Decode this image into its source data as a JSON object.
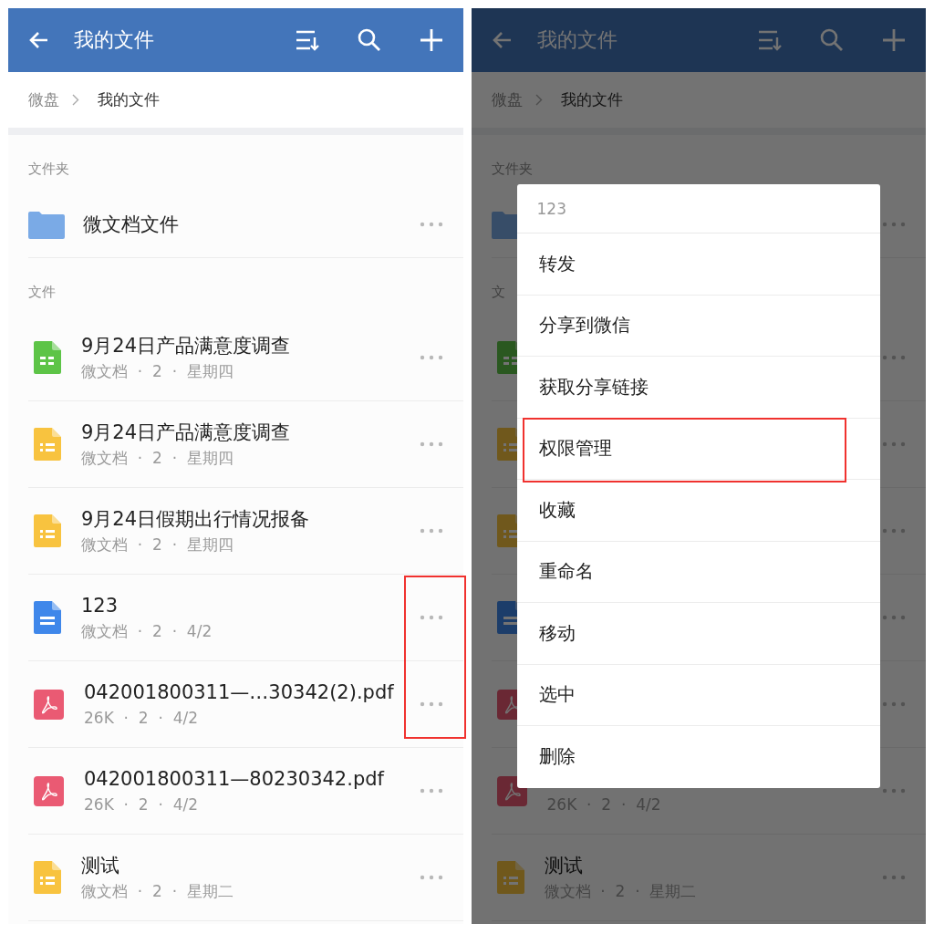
{
  "screens": [
    {
      "kind": "plain",
      "title": "我的文件",
      "breadcrumb": [
        {
          "label": "微盘",
          "current": false
        },
        {
          "label": "我的文件",
          "current": true
        }
      ],
      "sections": [
        {
          "label": "文件夹",
          "items": [
            {
              "kind": "folder",
              "name": "微文档文件",
              "highlighted": false
            }
          ]
        },
        {
          "label": "文件",
          "items": [
            {
              "kind": "sheet",
              "name": "9月24日产品满意度调查",
              "meta": "微文档  ·  2  ·  星期四",
              "highlighted": false
            },
            {
              "kind": "form",
              "name": "9月24日产品满意度调查",
              "meta": "微文档  ·  2  ·  星期四",
              "highlighted": false
            },
            {
              "kind": "form",
              "name": "9月24日假期出行情况报备",
              "meta": "微文档  ·  2  ·  星期四",
              "highlighted": false
            },
            {
              "kind": "doc",
              "name": "123",
              "meta": "微文档  ·  2  ·  4/2",
              "highlighted": true
            },
            {
              "kind": "pdf",
              "name": "042001800311—…30342(2).pdf",
              "meta": "26K  ·  2  ·  4/2",
              "highlighted": true
            },
            {
              "kind": "pdf",
              "name": "042001800311—80230342.pdf",
              "meta": "26K  ·  2  ·  4/2",
              "highlighted": false
            },
            {
              "kind": "form",
              "name": "测试",
              "meta": "微文档  ·  2  ·  星期二",
              "highlighted": false
            }
          ]
        }
      ]
    },
    {
      "kind": "menu",
      "title": "我的文件",
      "breadcrumb": [
        {
          "label": "微盘",
          "current": false
        },
        {
          "label": "我的文件",
          "current": true
        }
      ],
      "sections": [
        {
          "label": "文件夹",
          "items": [
            {
              "kind": "folder"
            }
          ]
        },
        {
          "label": "文",
          "items": [
            {
              "kind": "sheet"
            },
            {
              "kind": "form"
            },
            {
              "kind": "form"
            },
            {
              "kind": "doc"
            },
            {
              "kind": "pdf"
            },
            {
              "kind": "pdf",
              "meta": "26K  ·  2  ·  4/2"
            },
            {
              "kind": "form",
              "name": "测试",
              "meta": "微文档  ·  2  ·  星期二"
            }
          ]
        }
      ],
      "menu": {
        "title": "123",
        "items": [
          {
            "label": "转发",
            "highlighted": false
          },
          {
            "label": "分享到微信",
            "highlighted": false
          },
          {
            "label": "获取分享链接",
            "highlighted": false
          },
          {
            "label": "权限管理",
            "highlighted": true
          },
          {
            "label": "收藏",
            "highlighted": false
          },
          {
            "label": "重命名",
            "highlighted": false
          },
          {
            "label": "移动",
            "highlighted": false
          },
          {
            "label": "选中",
            "highlighted": false
          },
          {
            "label": "删除",
            "highlighted": false
          }
        ]
      }
    }
  ]
}
